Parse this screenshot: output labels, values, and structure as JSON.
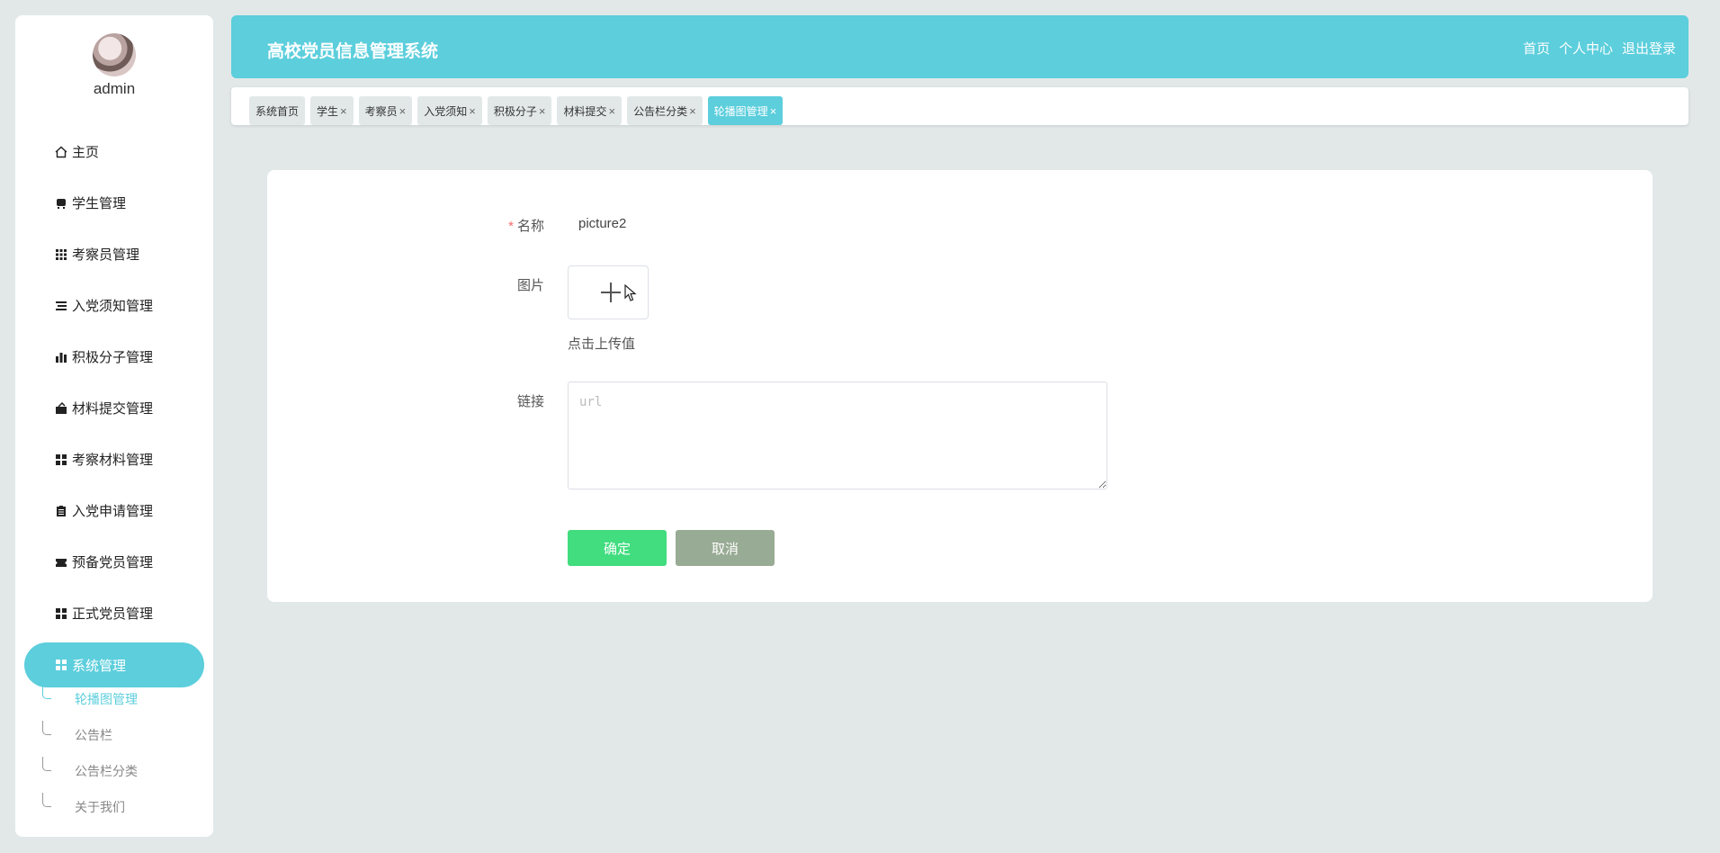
{
  "sidebar": {
    "username": "admin",
    "menu": [
      {
        "label": "主页",
        "icon": "home-icon"
      },
      {
        "label": "学生管理",
        "icon": "bus-icon"
      },
      {
        "label": "考察员管理",
        "icon": "grid-icon"
      },
      {
        "label": "入党须知管理",
        "icon": "list-icon"
      },
      {
        "label": "积极分子管理",
        "icon": "bar-chart-icon"
      },
      {
        "label": "材料提交管理",
        "icon": "folder-icon"
      },
      {
        "label": "考察材料管理",
        "icon": "apps-icon"
      },
      {
        "label": "入党申请管理",
        "icon": "clipboard-icon"
      },
      {
        "label": "预备党员管理",
        "icon": "ticket-icon"
      },
      {
        "label": "正式党员管理",
        "icon": "apps-icon"
      },
      {
        "label": "系统管理",
        "icon": "apps-icon",
        "active": true
      }
    ],
    "submenu": [
      {
        "label": "轮播图管理",
        "active": true
      },
      {
        "label": "公告栏"
      },
      {
        "label": "公告栏分类"
      },
      {
        "label": "关于我们"
      }
    ]
  },
  "header": {
    "title": "高校党员信息管理系统",
    "links": [
      "首页",
      "个人中心",
      "退出登录"
    ]
  },
  "tabs": [
    {
      "label": "系统首页",
      "closable": false
    },
    {
      "label": "学生",
      "closable": true
    },
    {
      "label": "考察员",
      "closable": true
    },
    {
      "label": "入党须知",
      "closable": true
    },
    {
      "label": "积极分子",
      "closable": true
    },
    {
      "label": "材料提交",
      "closable": true
    },
    {
      "label": "公告栏分类",
      "closable": true
    },
    {
      "label": "轮播图管理",
      "closable": true,
      "active": true
    }
  ],
  "form": {
    "name_label": "名称",
    "name_required": "*",
    "name_value": "picture2",
    "image_label": "图片",
    "upload_tip": "点击上传值",
    "link_label": "链接",
    "link_placeholder": "url",
    "link_value": "",
    "ok_label": "确定",
    "cancel_label": "取消"
  },
  "colors": {
    "accent": "#5ccedc",
    "ok": "#41dd7f",
    "cancel": "#98ab94",
    "background": "#e2e8e8"
  }
}
